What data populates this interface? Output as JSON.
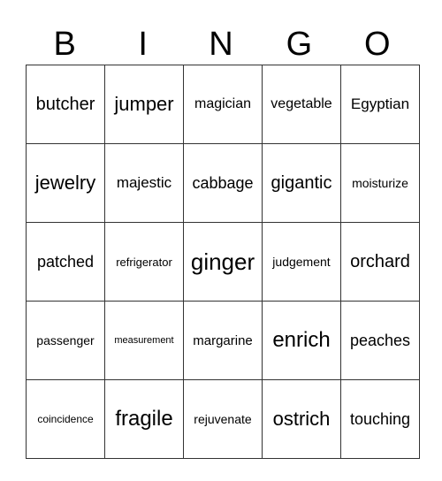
{
  "header": [
    "B",
    "I",
    "N",
    "G",
    "O"
  ],
  "rows": [
    [
      "butcher",
      "jumper",
      "magician",
      "vegetable",
      "Egyptian"
    ],
    [
      "jewelry",
      "majestic",
      "cabbage",
      "gigantic",
      "moisturize"
    ],
    [
      "patched",
      "refrigerator",
      "ginger",
      "judgement",
      "orchard"
    ],
    [
      "passenger",
      "measurement",
      "margarine",
      "enrich",
      "peaches"
    ],
    [
      "coincidence",
      "fragile",
      "rejuvenate",
      "ostrich",
      "touching"
    ]
  ]
}
